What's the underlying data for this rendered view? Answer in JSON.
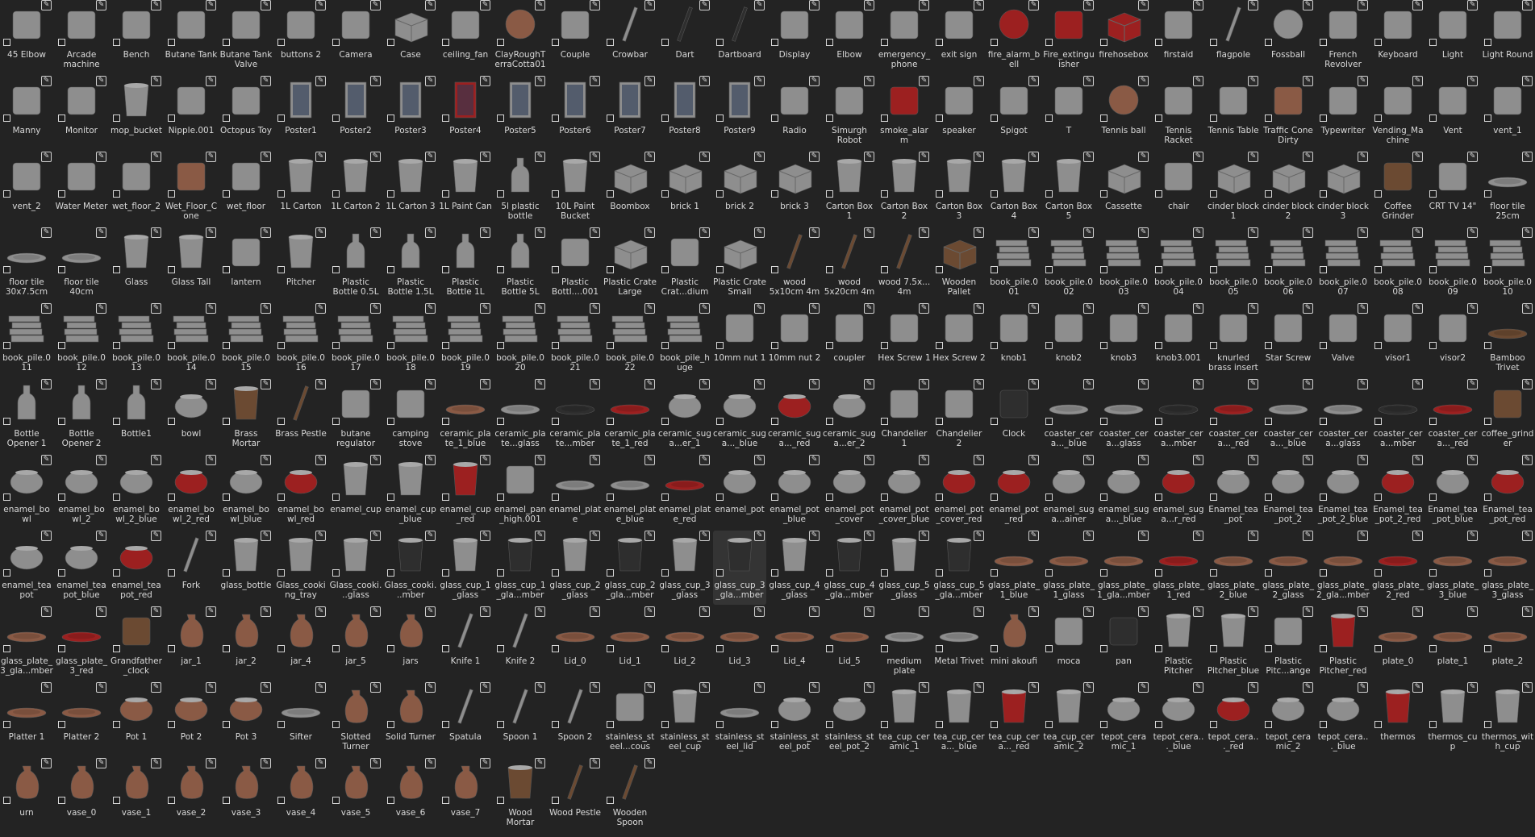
{
  "asset_browser": {
    "columns": 28,
    "active_item": "glass_cup_3_gla...mber",
    "colors": {
      "background": "#232323",
      "label": "#d9d9d9",
      "wood": "#6b4a32",
      "metal": "#8e8e8e",
      "red": "#9c2020",
      "clay": "#8a5a45",
      "dark": "#2e2e2e"
    },
    "rows": [
      [
        "45 Elbow",
        "Arcade machine",
        "Bench",
        "Butane Tank",
        "Butane Tank Valve",
        "buttons 2",
        "Camera",
        "Case",
        "ceiling_fan",
        "ClayRoughTerraCotta01",
        "Couple",
        "Crowbar",
        "Dart",
        "Dartboard",
        "Display",
        "Elbow",
        "emergency_phone",
        "exit sign",
        "fire_alarm_bell",
        "Fire_extinguisher",
        "firehosebox",
        "firstaid",
        "flagpole",
        "Fossball",
        "French Revolver",
        "Keyboard",
        "Light",
        "Light Round"
      ],
      [
        "Manny",
        "Monitor",
        "mop_bucket",
        "Nipple.001",
        "Octopus Toy",
        "Poster1",
        "Poster2",
        "Poster3",
        "Poster4",
        "Poster5",
        "Poster6",
        "Poster7",
        "Poster8",
        "Poster9",
        "Radio",
        "Simurgh Robot",
        "smoke_alarm",
        "speaker",
        "Spigot",
        "T",
        "Tennis ball",
        "Tennis Racket",
        "Tennis Table",
        "Traffic Cone Dirty",
        "Typewriter",
        "Vending_Machine",
        "Vent",
        "vent_1"
      ],
      [
        "vent_2",
        "Water Meter",
        "wet_floor_2",
        "Wet_Floor_Cone",
        "wet_floor",
        "1L Carton",
        "1L Carton 2",
        "1L Carton 3",
        "1L Paint Can",
        "5l plastic bottle",
        "10L Paint Bucket",
        "Boombox",
        "brick 1",
        "brick 2",
        "brick 3",
        "Carton Box 1",
        "Carton Box 2",
        "Carton Box 3",
        "Carton Box 4",
        "Carton Box 5",
        "Cassette",
        "chair",
        "cinder block 1",
        "cinder block 2",
        "cinder block 3",
        "Coffee Grinder",
        "CRT TV 14\"",
        "floor tile 25cm"
      ],
      [
        "floor tile 30x7.5cm",
        "floor tile 40cm",
        "Glass",
        "Glass Tall",
        "lantern",
        "Pitcher",
        "Plastic Bottle 0.5L",
        "Plastic Bottle 1.5L",
        "Plastic Bottle 1L",
        "Plastic Bottle 5L",
        "Plastic Bottl....001",
        "Plastic Crate Large",
        "Plastic Crat...dium",
        "Plastic Crate Small",
        "wood 5x10cm 4m",
        "wood 5x20cm 4m",
        "wood 7.5x... 4m",
        "Wooden Pallet",
        "book_pile.001",
        "book_pile.002",
        "book_pile.003",
        "book_pile.004",
        "book_pile.005",
        "book_pile.006",
        "book_pile.007",
        "book_pile.008",
        "book_pile.009",
        "book_pile.010"
      ],
      [
        "book_pile.011",
        "book_pile.012",
        "book_pile.013",
        "book_pile.014",
        "book_pile.015",
        "book_pile.016",
        "book_pile.017",
        "book_pile.018",
        "book_pile.019",
        "book_pile.020",
        "book_pile.021",
        "book_pile.022",
        "book_pile_huge",
        "10mm nut 1",
        "10mm nut 2",
        "coupler",
        "Hex Screw 1",
        "Hex Screw 2",
        "knob1",
        "knob2",
        "knob3",
        "knob3.001",
        "knurled brass insert",
        "Star Screw",
        "Valve",
        "visor1",
        "visor2",
        "Bamboo Trivet"
      ],
      [
        "Bottle Opener 1",
        "Bottle Opener 2",
        "Bottle1",
        "bowl",
        "Brass Mortar",
        "Brass Pestle",
        "butane regulator",
        "camping stove",
        "ceramic_plate_1_blue",
        "ceramic_plate...glass",
        "ceramic_plate...mber",
        "ceramic_plate_1_red",
        "ceramic_suga...er_1",
        "ceramic_suga..._blue",
        "ceramic_suga..._red",
        "ceramic_suga...er_2",
        "Chandelier 1",
        "Chandelier 2",
        "Clock",
        "coaster_cera..._blue",
        "coaster_cera...glass",
        "coaster_cera...mber",
        "coaster_cera..._red",
        "coaster_cera..._blue",
        "coaster_cera...glass",
        "coaster_cera...mber",
        "coaster_cera..._red",
        "coffee_grinder"
      ],
      [
        "enamel_bowl",
        "enamel_bowl_2",
        "enamel_bowl_2_blue",
        "enamel_bowl_2_red",
        "enamel_bowl_blue",
        "enamel_bowl_red",
        "enamel_cup",
        "enamel_cup_blue",
        "enamel_cup_red",
        "enamel_pan_high.001",
        "enamel_plate",
        "enamel_plate_blue",
        "enamel_plate_red",
        "enamel_pot",
        "enamel_pot_blue",
        "enamel_pot_cover",
        "enamel_pot_cover_blue",
        "enamel_pot_cover_red",
        "enamel_pot_red",
        "enamel_suga...ainer",
        "enamel_suga..._blue",
        "enamel_suga...r_red",
        "Enamel_tea_pot",
        "Enamel_tea_pot_2",
        "Enamel_tea_pot_2_blue",
        "Enamel_tea_pot_2_red",
        "Enamel_tea_pot_blue",
        "Enamel_tea_pot_red"
      ],
      [
        "enamel_teapot",
        "enamel_teapot_blue",
        "enamel_teapot_red",
        "Fork",
        "glass_bottle",
        "Glass_cooking_tray",
        "Glass_cooki...glass",
        "Glass_cooki...mber",
        "glass_cup_1_glass",
        "glass_cup_1_gla...mber",
        "glass_cup_2_glass",
        "glass_cup_2_gla...mber",
        "glass_cup_3_glass",
        "glass_cup_3_gla...mber",
        "glass_cup_4_glass",
        "glass_cup_4_gla...mber",
        "glass_cup_5_glass",
        "glass_cup_5_gla...mber",
        "glass_plate_1_blue",
        "glass_plate_1_glass",
        "glass_plate_1_gla...mber",
        "glass_plate_1_red",
        "glass_plate_2_blue",
        "glass_plate_2_glass",
        "glass_plate_2_gla...mber",
        "glass_plate_2_red",
        "glass_plate_3_blue",
        "glass_plate_3_glass"
      ],
      [
        "glass_plate_3_gla...mber",
        "glass_plate_3_red",
        "Grandfather_clock",
        "jar_1",
        "jar_2",
        "jar_4",
        "jar_5",
        "jars",
        "Knife 1",
        "Knife 2",
        "Lid_0",
        "Lid_1",
        "Lid_2",
        "Lid_3",
        "Lid_4",
        "Lid_5",
        "medium plate",
        "Metal Trivet",
        "mini akoufi",
        "moca",
        "pan",
        "Plastic Pitcher",
        "Plastic Pitcher_blue",
        "Plastic Pitc...ange",
        "Plastic Pitcher_red",
        "plate_0",
        "plate_1",
        "plate_2"
      ],
      [
        "Platter 1",
        "Platter 2",
        "Pot 1",
        "Pot 2",
        "Pot 3",
        "Sifter",
        "Slotted Turner",
        "Solid Turner",
        "Spatula",
        "Spoon 1",
        "Spoon 2",
        "stainless_steel...cous",
        "stainless_steel_cup",
        "stainless_steel_lid",
        "stainless_steel_pot",
        "stainless_steel_pot_2",
        "tea_cup_ceramic_1",
        "tea_cup_cera..._blue",
        "tea_cup_cera..._red",
        "tea_cup_ceramic_2",
        "tepot_ceramic_1",
        "tepot_cera..._blue",
        "tepot_cera..._red",
        "tepot_ceramic_2",
        "tepot_cera..._blue",
        "thermos",
        "thermos_cup",
        "thermos_with_cup"
      ],
      [
        "urn",
        "vase_0",
        "vase_1",
        "vase_2",
        "vase_3",
        "vase_4",
        "vase_5",
        "vase_6",
        "vase_7",
        "Wood Mortar",
        "Wood Pestle",
        "Wooden Spoon"
      ]
    ],
    "icons": {
      "edit": "edit-icon",
      "select": "checkbox"
    }
  }
}
